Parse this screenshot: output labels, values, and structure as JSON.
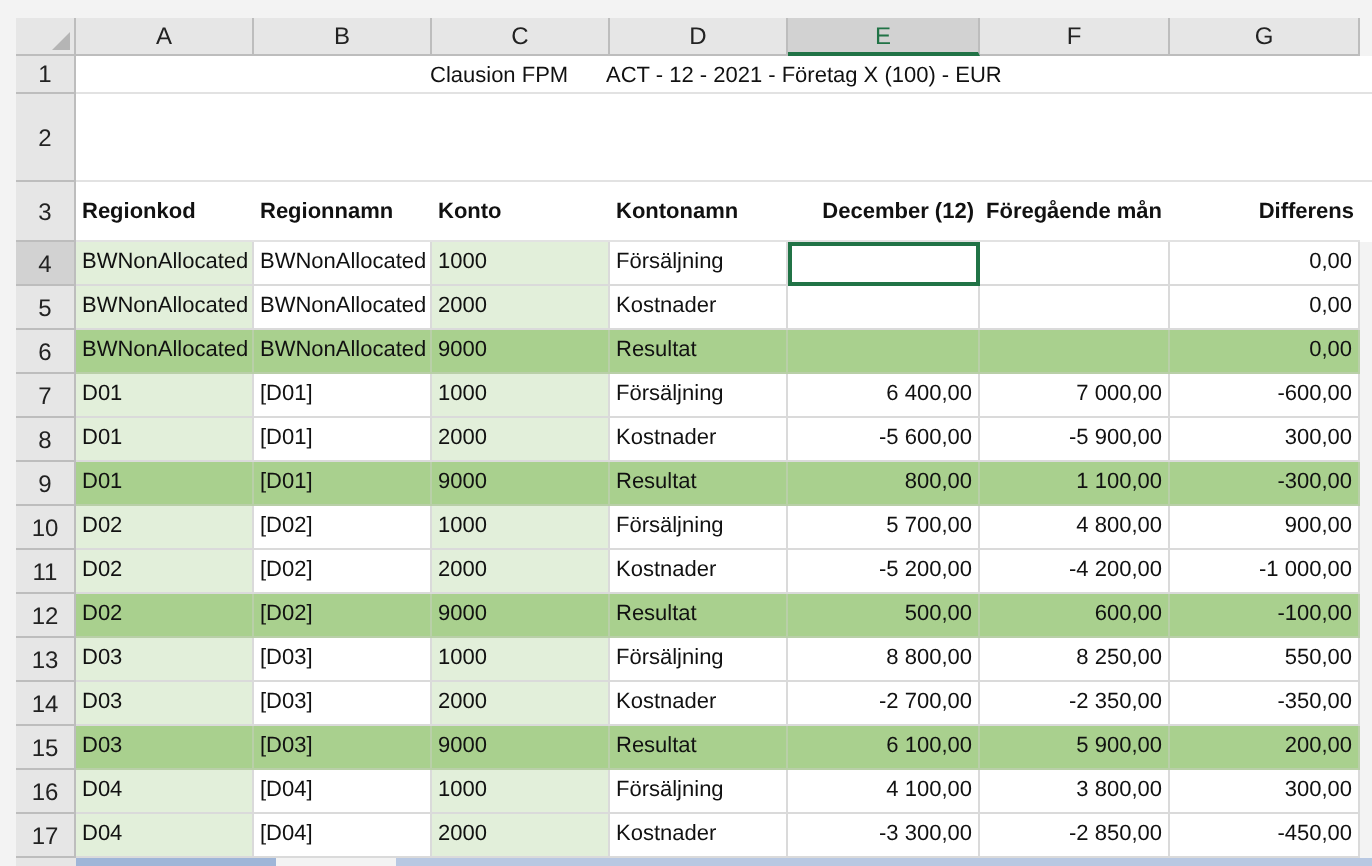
{
  "columns": [
    {
      "label": "A",
      "selected": false
    },
    {
      "label": "B",
      "selected": false
    },
    {
      "label": "C",
      "selected": false
    },
    {
      "label": "D",
      "selected": false
    },
    {
      "label": "E",
      "selected": true
    },
    {
      "label": "F",
      "selected": false
    },
    {
      "label": "G",
      "selected": false
    }
  ],
  "title_row": {
    "number": "1",
    "app": "Clausion FPM",
    "context": "ACT - 12 - 2021 - Företag X (100) - EUR"
  },
  "blank_row": {
    "number": "2"
  },
  "header_row": {
    "number": "3",
    "cells": [
      "Regionkod",
      "Regionnamn",
      "Konto",
      "Kontonamn",
      "December  (12)",
      "Föregående mån",
      "Differens"
    ]
  },
  "rows": [
    {
      "number": "4",
      "kind": "detail",
      "selected": true,
      "cells": [
        "BWNonAllocated",
        "BWNonAllocated",
        "1000",
        "Försäljning",
        "",
        "",
        "0,00"
      ]
    },
    {
      "number": "5",
      "kind": "detail",
      "selected": false,
      "cells": [
        "BWNonAllocated",
        "BWNonAllocated",
        "2000",
        "Kostnader",
        "",
        "",
        "0,00"
      ]
    },
    {
      "number": "6",
      "kind": "total",
      "selected": false,
      "cells": [
        "BWNonAllocated",
        "BWNonAllocated",
        "9000",
        "Resultat",
        "",
        "",
        "0,00"
      ]
    },
    {
      "number": "7",
      "kind": "detail",
      "selected": false,
      "cells": [
        "D01",
        "[D01]",
        "1000",
        "Försäljning",
        "6 400,00",
        "7 000,00",
        "-600,00"
      ]
    },
    {
      "number": "8",
      "kind": "detail",
      "selected": false,
      "cells": [
        "D01",
        "[D01]",
        "2000",
        "Kostnader",
        "-5 600,00",
        "-5 900,00",
        "300,00"
      ]
    },
    {
      "number": "9",
      "kind": "total",
      "selected": false,
      "cells": [
        "D01",
        "[D01]",
        "9000",
        "Resultat",
        "800,00",
        "1 100,00",
        "-300,00"
      ]
    },
    {
      "number": "10",
      "kind": "detail",
      "selected": false,
      "cells": [
        "D02",
        "[D02]",
        "1000",
        "Försäljning",
        "5 700,00",
        "4 800,00",
        "900,00"
      ]
    },
    {
      "number": "11",
      "kind": "detail",
      "selected": false,
      "cells": [
        "D02",
        "[D02]",
        "2000",
        "Kostnader",
        "-5 200,00",
        "-4 200,00",
        "-1 000,00"
      ]
    },
    {
      "number": "12",
      "kind": "total",
      "selected": false,
      "cells": [
        "D02",
        "[D02]",
        "9000",
        "Resultat",
        "500,00",
        "600,00",
        "-100,00"
      ]
    },
    {
      "number": "13",
      "kind": "detail",
      "selected": false,
      "cells": [
        "D03",
        "[D03]",
        "1000",
        "Försäljning",
        "8 800,00",
        "8 250,00",
        "550,00"
      ]
    },
    {
      "number": "14",
      "kind": "detail",
      "selected": false,
      "cells": [
        "D03",
        "[D03]",
        "2000",
        "Kostnader",
        "-2 700,00",
        "-2 350,00",
        "-350,00"
      ]
    },
    {
      "number": "15",
      "kind": "total",
      "selected": false,
      "cells": [
        "D03",
        "[D03]",
        "9000",
        "Resultat",
        "6 100,00",
        "5 900,00",
        "200,00"
      ]
    },
    {
      "number": "16",
      "kind": "detail",
      "selected": false,
      "cells": [
        "D04",
        "[D04]",
        "1000",
        "Försäljning",
        "4 100,00",
        "3 800,00",
        "300,00"
      ]
    },
    {
      "number": "17",
      "kind": "detail",
      "selected": false,
      "cells": [
        "D04",
        "[D04]",
        "2000",
        "Kostnader",
        "-3 300,00",
        "-2 850,00",
        "-450,00"
      ]
    }
  ]
}
